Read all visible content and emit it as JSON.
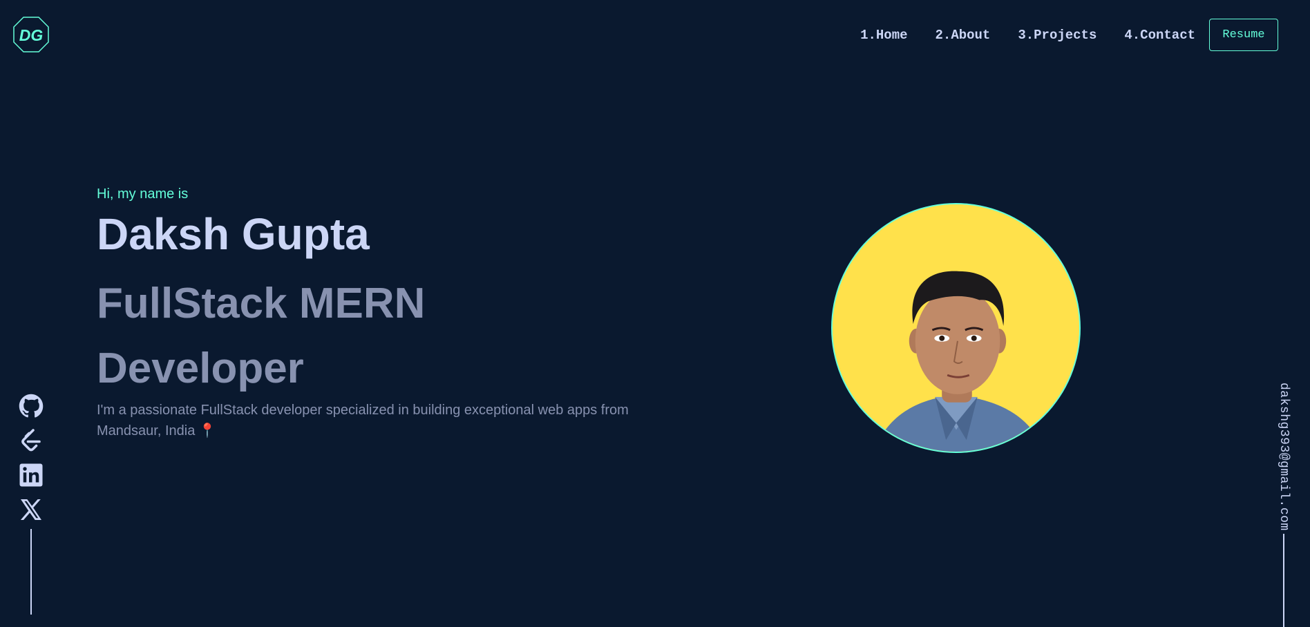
{
  "header": {
    "logo_text": "DG",
    "nav": [
      {
        "label": "1.Home"
      },
      {
        "label": "2.About"
      },
      {
        "label": "3.Projects"
      },
      {
        "label": "4.Contact"
      }
    ],
    "resume_label": "Resume"
  },
  "hero": {
    "greeting": "Hi, my name is",
    "name": "Daksh Gupta",
    "role": "FullStack MERN Developer",
    "bio": "I'm a passionate FullStack developer specialized in building exceptional web apps from Mandsaur, India",
    "pin_glyph": "📍"
  },
  "social": {
    "icons": [
      "github-icon",
      "leetcode-icon",
      "linkedin-icon",
      "x-icon"
    ]
  },
  "email": "dakshg393@gmail.com",
  "colors": {
    "background": "#0a192f",
    "accent": "#64ffda",
    "heading": "#ccd6f6",
    "muted": "#8892b0",
    "avatar_bg": "#ffe14b"
  }
}
